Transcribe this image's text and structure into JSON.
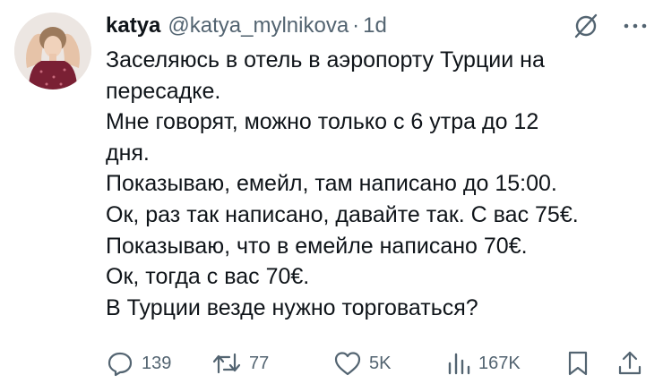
{
  "tweet": {
    "author_name": "katya",
    "author_handle": "@katya_mylnikova",
    "separator": "·",
    "time": "1d",
    "text_lines": [
      "Заселяюсь в отель в аэропорту Турции на",
      "пересадке.",
      "Мне говорят, можно только с 6 утра до 12",
      "дня.",
      "Показываю, емейл, там написано до 15:00.",
      "Ок, раз так написано, давайте так. С вас 75€.",
      "Показываю, что в емейле написано 70€.",
      "Ок, тогда с вас 70€.",
      "В Турции везде нужно торговаться?"
    ]
  },
  "icons": {
    "grok": "grok-icon",
    "more": "more-icon",
    "reply": "reply-icon",
    "retweet": "retweet-icon",
    "like": "like-icon",
    "views": "views-icon",
    "bookmark": "bookmark-icon",
    "share": "share-icon"
  },
  "actions": {
    "replies": "139",
    "retweets": "77",
    "likes": "5K",
    "views": "167K"
  },
  "colors": {
    "text": "#0f1419",
    "secondary": "#536471",
    "background": "#ffffff"
  }
}
